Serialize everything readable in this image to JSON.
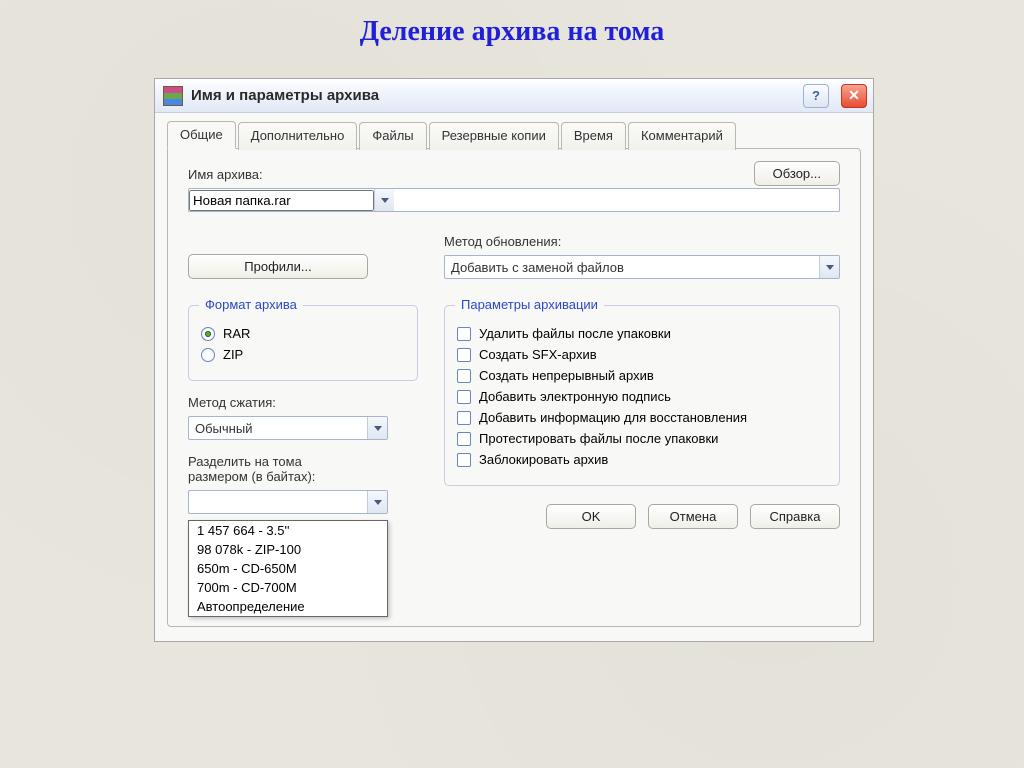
{
  "page_heading": "Деление архива на тома",
  "window": {
    "title": "Имя и параметры архива"
  },
  "tabs": [
    "Общие",
    "Дополнительно",
    "Файлы",
    "Резервные копии",
    "Время",
    "Комментарий"
  ],
  "active_tab_index": 0,
  "panel": {
    "browse_btn": "Обзор...",
    "archive_name_label": "Имя архива:",
    "archive_name_value": "Новая папка.rar",
    "update_method_label": "Метод обновления:",
    "update_method_value": "Добавить с заменой файлов",
    "profiles_btn": "Профили...",
    "format_group": {
      "legend": "Формат архива",
      "options": [
        "RAR",
        "ZIP"
      ],
      "selected": 0
    },
    "compression_label": "Метод сжатия:",
    "compression_value": "Обычный",
    "split_label_line1": "Разделить на тома",
    "split_label_line2": "размером (в байтах):",
    "split_value": "",
    "split_options": [
      "1 457 664 - 3.5''",
      "98 078k - ZIP-100",
      "650m - CD-650M",
      "700m - CD-700M",
      "Автоопределение"
    ],
    "params_group": {
      "legend": "Параметры архивации",
      "items": [
        "Удалить файлы после упаковки",
        "Создать SFX-архив",
        "Создать непрерывный архив",
        "Добавить электронную подпись",
        "Добавить информацию для восстановления",
        "Протестировать файлы после упаковки",
        "Заблокировать архив"
      ]
    }
  },
  "buttons": {
    "ok": "OK",
    "cancel": "Отмена",
    "help": "Справка"
  }
}
